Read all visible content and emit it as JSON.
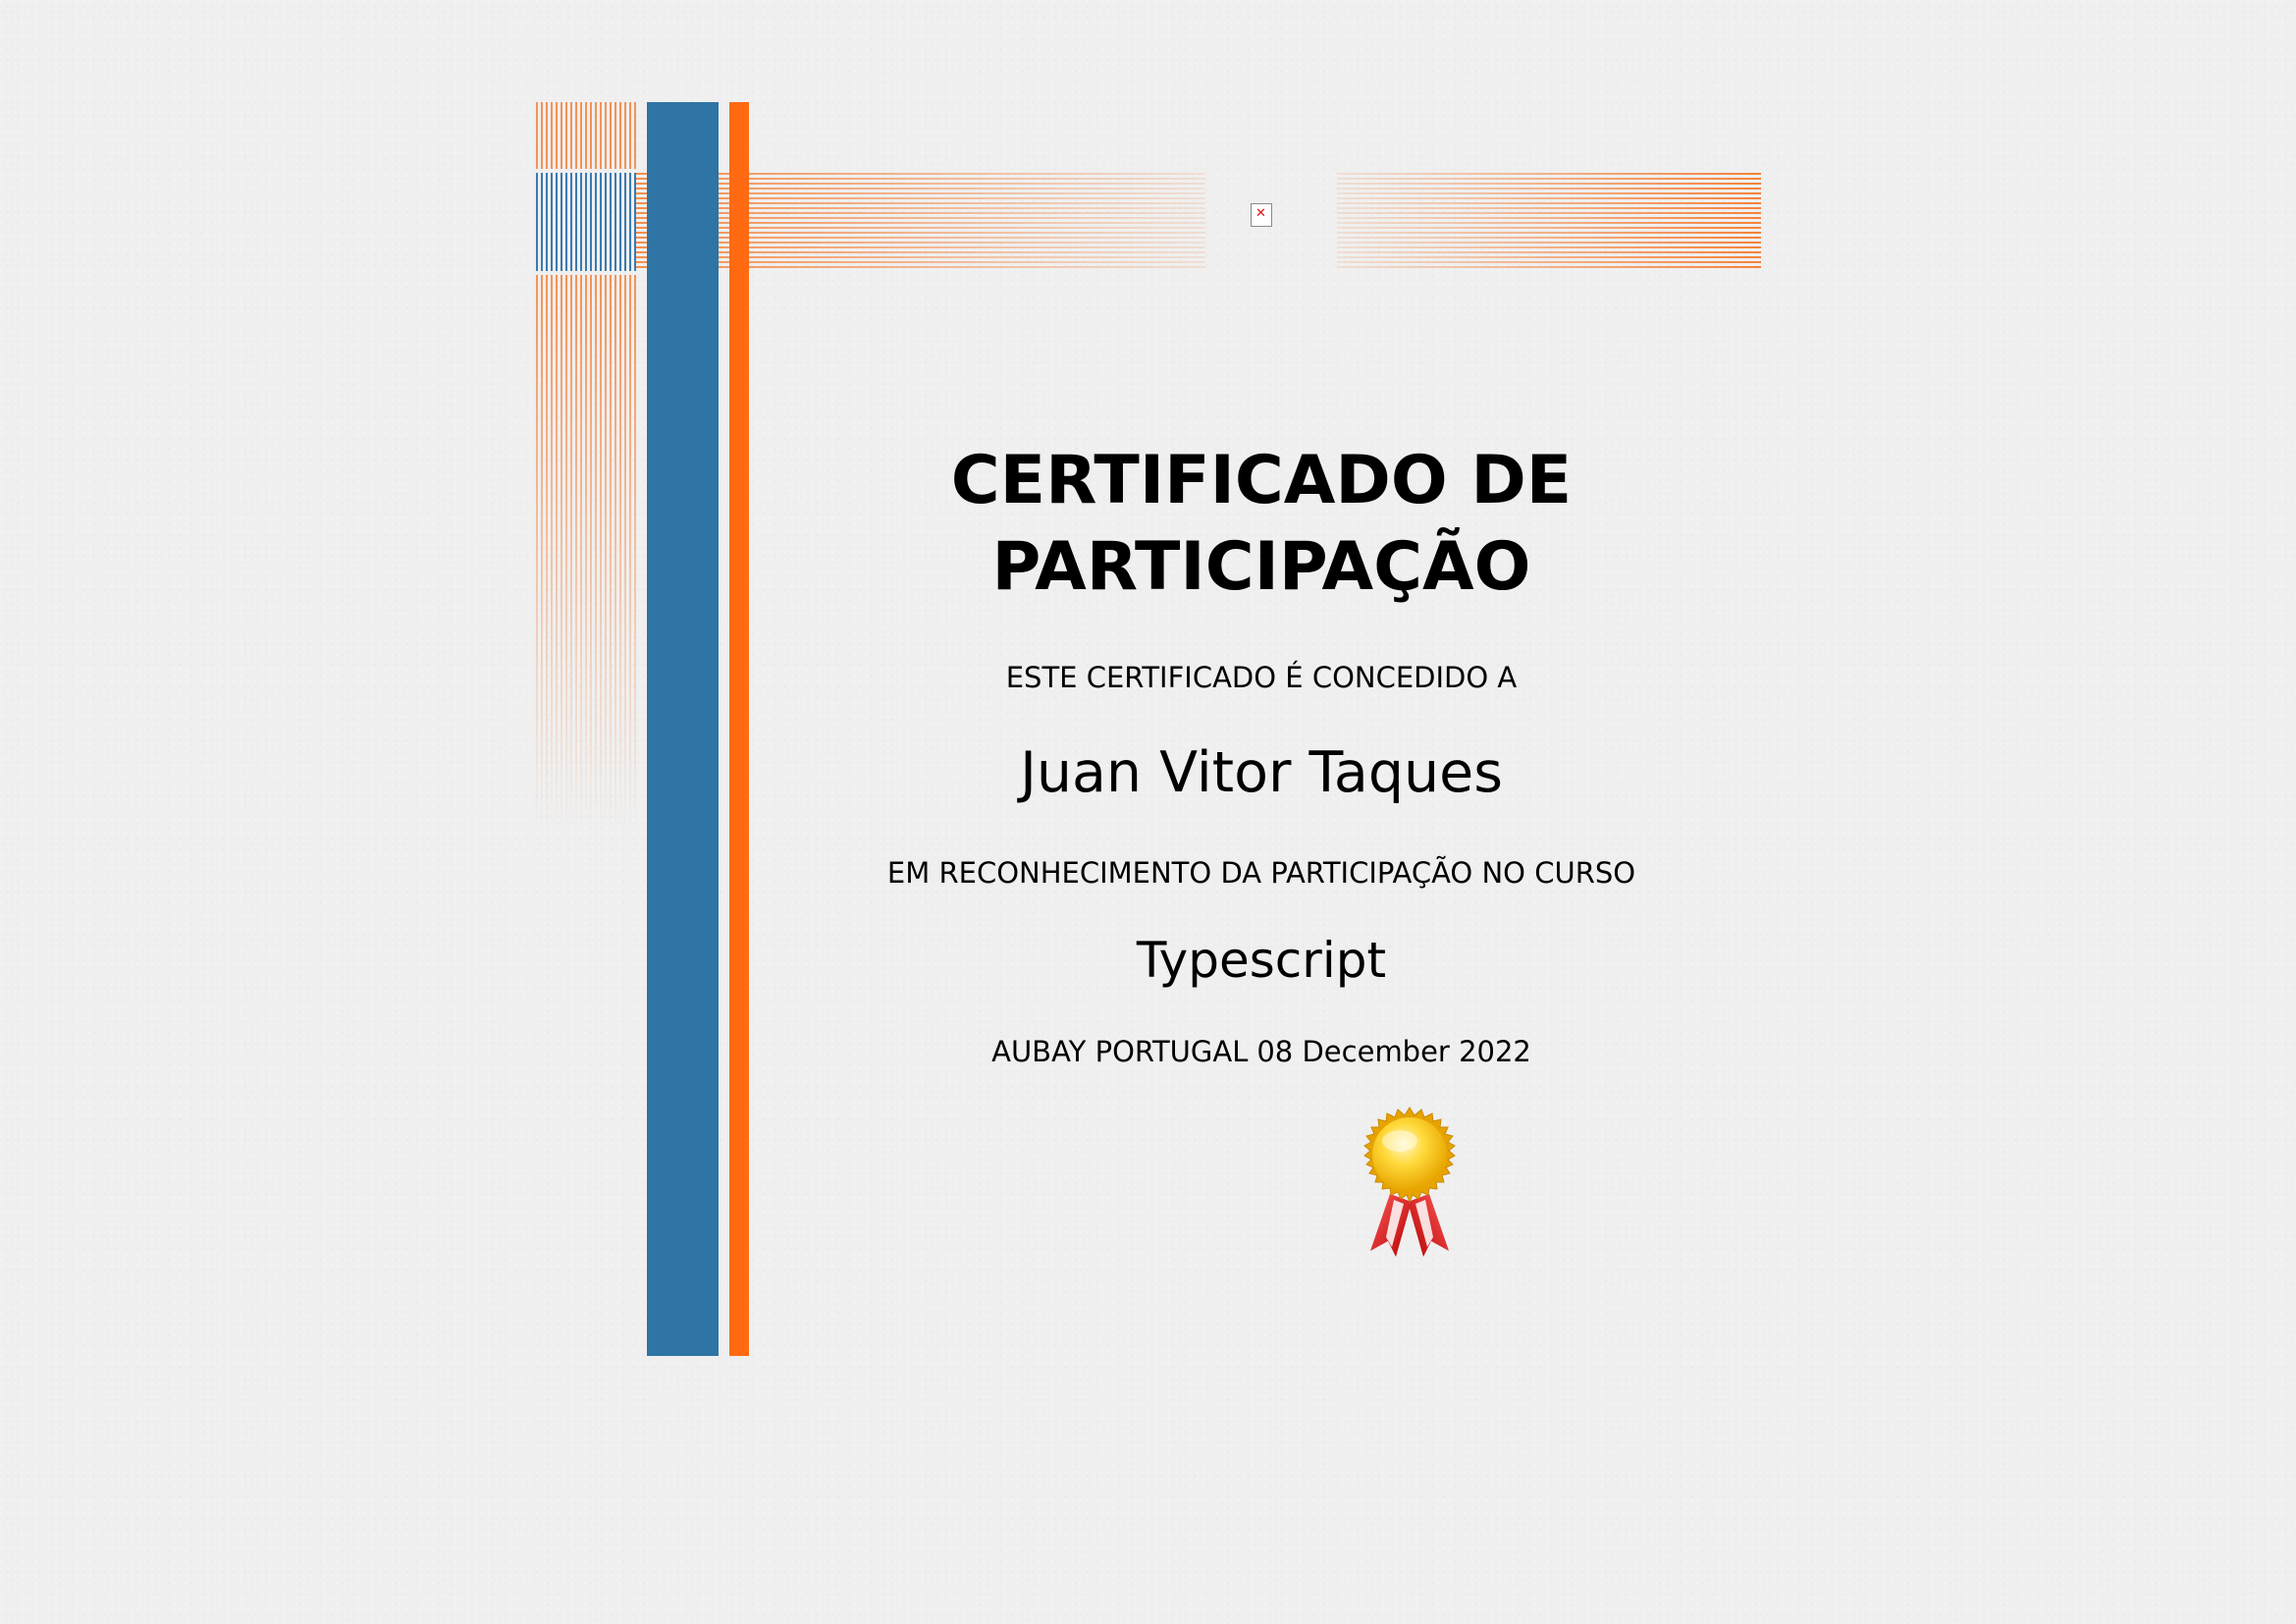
{
  "certificate": {
    "title_line1": "CERTIFICADO DE",
    "title_line2": "PARTICIPAÇÃO",
    "granted_to_label": "ESTE CERTIFICADO É CONCEDIDO A",
    "recipient_name": "Juan Vitor Taques",
    "recognition_label": "EM RECONHECIMENTO DA PARTICIPAÇÃO NO CURSO",
    "course_name": "Typescript",
    "issuer": "AUBAY PORTUGAL",
    "date": "08 December 2022"
  },
  "decorations": {
    "broken_image_icon": "broken-image-icon",
    "seal_icon": "award-seal-icon"
  },
  "colors": {
    "background": "#efefef",
    "accent_blue": "#2e74a4",
    "accent_orange": "#ff6a13",
    "text": "#000000"
  }
}
